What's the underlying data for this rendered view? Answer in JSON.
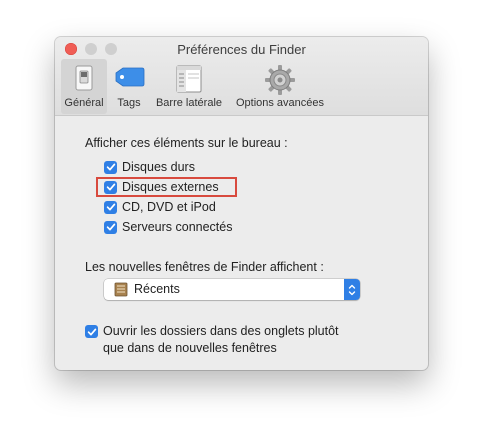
{
  "window": {
    "title": "Préférences du Finder"
  },
  "toolbar": {
    "tabs": [
      {
        "label": "Général",
        "icon": "general-switch-icon",
        "active": true
      },
      {
        "label": "Tags",
        "icon": "tag-icon",
        "active": false
      },
      {
        "label": "Barre latérale",
        "icon": "sidebar-icon",
        "active": false
      },
      {
        "label": "Options avancées",
        "icon": "gear-icon",
        "active": false
      }
    ]
  },
  "desktop_section": {
    "label": "Afficher ces éléments sur le bureau :",
    "items": [
      {
        "label": "Disques durs",
        "checked": true
      },
      {
        "label": "Disques externes",
        "checked": true,
        "highlighted": true
      },
      {
        "label": "CD, DVD et iPod",
        "checked": true
      },
      {
        "label": "Serveurs connectés",
        "checked": true
      }
    ]
  },
  "new_windows": {
    "label": "Les nouvelles fenêtres de Finder affichent :",
    "selected_value": "Récents",
    "icon": "recents-icon"
  },
  "tabs_option": {
    "label_line1": "Ouvrir les dossiers dans des onglets plutôt",
    "label_line2": "que dans de nouvelles fenêtres",
    "checked": true
  },
  "colors": {
    "accent": "#2f7fe5",
    "highlight": "#d84a3e",
    "close_button": "#f05d55"
  }
}
